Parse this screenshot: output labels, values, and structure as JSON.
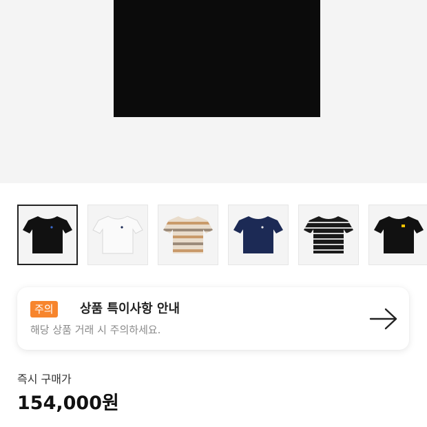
{
  "product": {
    "hero_image": "black-tshirt-photo",
    "thumbnails": [
      {
        "icon": "black-tshirt",
        "color": "#111111",
        "selected": true
      },
      {
        "icon": "white-tshirt",
        "color": "#f7f7f7",
        "selected": false
      },
      {
        "icon": "beige-striped-tshirt",
        "color": "#d9c2a6",
        "selected": false
      },
      {
        "icon": "navy-tshirt",
        "color": "#1c2a55",
        "selected": false
      },
      {
        "icon": "black-striped-tshirt",
        "color": "#1a1a1a",
        "selected": false
      },
      {
        "icon": "black-tshirt-yellow-tag",
        "color": "#111111",
        "selected": false
      }
    ]
  },
  "notice": {
    "badge": "주의",
    "title": "상품 특이사항 안내",
    "description": "해당 상품 거래 시 주의하세요.",
    "arrow_icon": "arrow-right-icon"
  },
  "purchase": {
    "label": "즉시 구매가",
    "price": "154,000원"
  },
  "colors": {
    "accent": "#f7852d",
    "background": "#f4f4f4"
  }
}
